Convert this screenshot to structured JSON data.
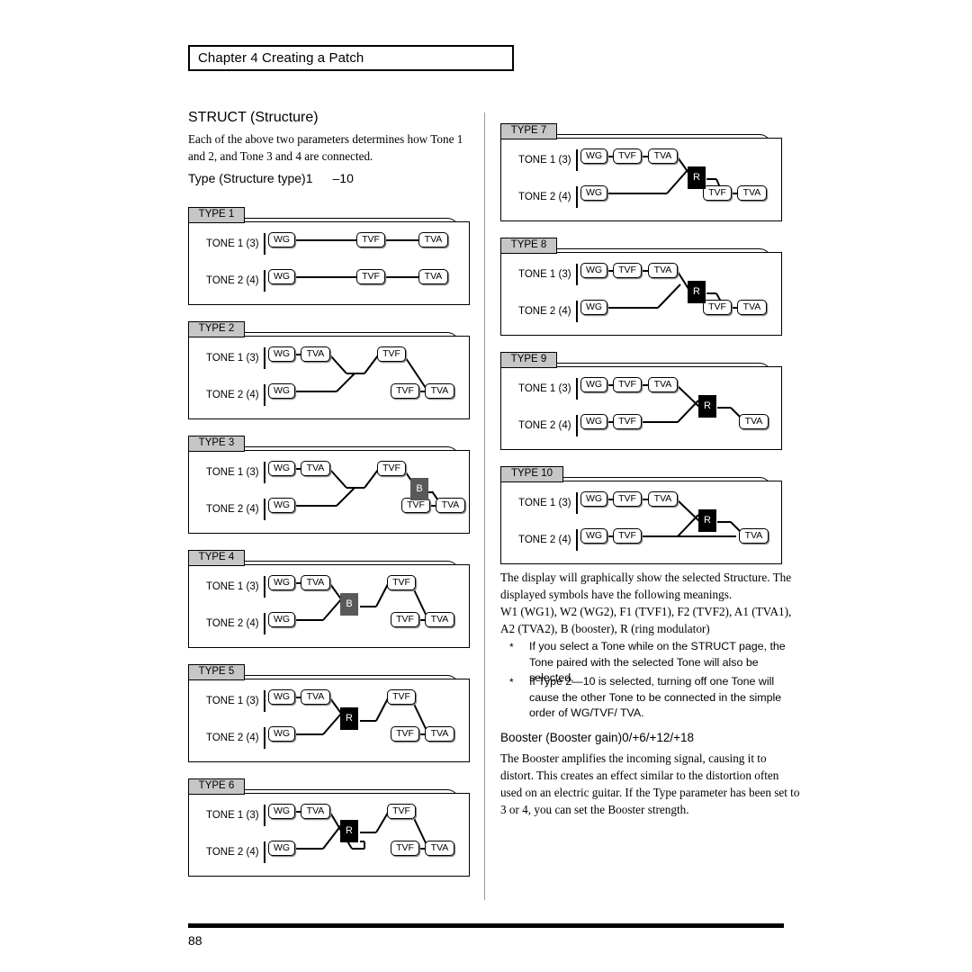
{
  "header": {
    "chapter_title": "Chapter 4 Creating a Patch"
  },
  "section": {
    "title": "STRUCT (Structure)",
    "lead": "Each of the above two parameters determines how Tone 1 and 2, and Tone 3 and 4 are connected.",
    "type_param_label": "Type (Structure type)1",
    "type_param_range": "–10"
  },
  "labels": {
    "tone1": "TONE 1 (3)",
    "tone2": "TONE 2 (4)",
    "wg": "WG",
    "tvf": "TVF",
    "tva": "TVA",
    "booster": "B",
    "ring": "R"
  },
  "diagrams": [
    {
      "tab": "TYPE 1"
    },
    {
      "tab": "TYPE 2"
    },
    {
      "tab": "TYPE 3"
    },
    {
      "tab": "TYPE 4"
    },
    {
      "tab": "TYPE 5"
    },
    {
      "tab": "TYPE 6"
    },
    {
      "tab": "TYPE 7"
    },
    {
      "tab": "TYPE 8"
    },
    {
      "tab": "TYPE 9"
    },
    {
      "tab": "TYPE 10"
    }
  ],
  "right_column": {
    "display_paragraph": "The display will graphically show the selected Structure. The displayed symbols have the following meanings.",
    "symbols_paragraph": "W1 (WG1), W2 (WG2), F1 (TVF1), F2 (TVF2), A1 (TVA1), A2 (TVA2), B (booster), R (ring modulator)",
    "note_marker": "*",
    "note1": "If you select a Tone while on the STRUCT page, the Tone paired with the selected Tone will also be selected.",
    "note2": "If Type 2—10 is selected, turning off one Tone will cause the other Tone to be connected in the simple order of WG/TVF/ TVA.",
    "booster_title": "Booster (Booster gain)0/+6/+12/+18",
    "booster_paragraph": "The Booster amplifies the incoming signal, causing it to distort. This creates an effect similar to the distortion often used on an electric guitar. If the  Type  parameter has been set to 3 or 4, you can set the Booster strength."
  },
  "footer": {
    "page_number": "88"
  },
  "colors": {
    "tab_fill": "#c6c6c6",
    "booster_fill": "#595959",
    "ring_fill": "#000000",
    "shadow": "#8d8d8d"
  }
}
